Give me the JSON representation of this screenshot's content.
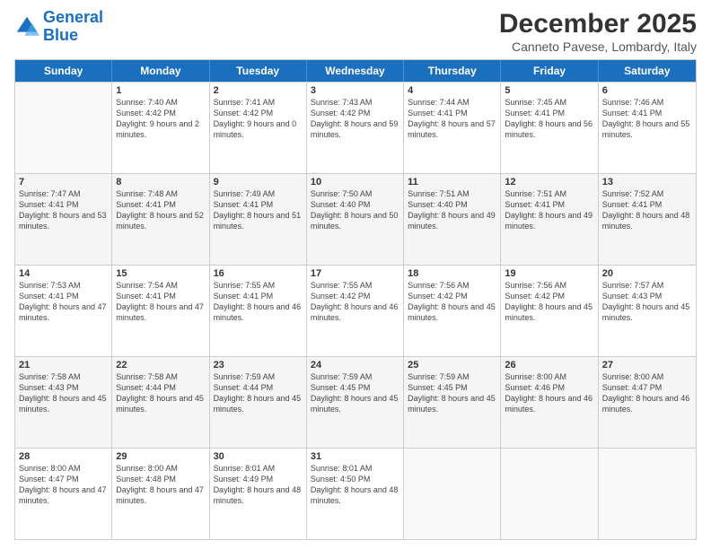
{
  "logo": {
    "line1": "General",
    "line2": "Blue"
  },
  "header": {
    "month": "December 2025",
    "location": "Canneto Pavese, Lombardy, Italy"
  },
  "days": [
    "Sunday",
    "Monday",
    "Tuesday",
    "Wednesday",
    "Thursday",
    "Friday",
    "Saturday"
  ],
  "rows": [
    [
      {
        "day": "",
        "sunrise": "",
        "sunset": "",
        "daylight": ""
      },
      {
        "day": "1",
        "sunrise": "Sunrise: 7:40 AM",
        "sunset": "Sunset: 4:42 PM",
        "daylight": "Daylight: 9 hours and 2 minutes."
      },
      {
        "day": "2",
        "sunrise": "Sunrise: 7:41 AM",
        "sunset": "Sunset: 4:42 PM",
        "daylight": "Daylight: 9 hours and 0 minutes."
      },
      {
        "day": "3",
        "sunrise": "Sunrise: 7:43 AM",
        "sunset": "Sunset: 4:42 PM",
        "daylight": "Daylight: 8 hours and 59 minutes."
      },
      {
        "day": "4",
        "sunrise": "Sunrise: 7:44 AM",
        "sunset": "Sunset: 4:41 PM",
        "daylight": "Daylight: 8 hours and 57 minutes."
      },
      {
        "day": "5",
        "sunrise": "Sunrise: 7:45 AM",
        "sunset": "Sunset: 4:41 PM",
        "daylight": "Daylight: 8 hours and 56 minutes."
      },
      {
        "day": "6",
        "sunrise": "Sunrise: 7:46 AM",
        "sunset": "Sunset: 4:41 PM",
        "daylight": "Daylight: 8 hours and 55 minutes."
      }
    ],
    [
      {
        "day": "7",
        "sunrise": "Sunrise: 7:47 AM",
        "sunset": "Sunset: 4:41 PM",
        "daylight": "Daylight: 8 hours and 53 minutes."
      },
      {
        "day": "8",
        "sunrise": "Sunrise: 7:48 AM",
        "sunset": "Sunset: 4:41 PM",
        "daylight": "Daylight: 8 hours and 52 minutes."
      },
      {
        "day": "9",
        "sunrise": "Sunrise: 7:49 AM",
        "sunset": "Sunset: 4:41 PM",
        "daylight": "Daylight: 8 hours and 51 minutes."
      },
      {
        "day": "10",
        "sunrise": "Sunrise: 7:50 AM",
        "sunset": "Sunset: 4:40 PM",
        "daylight": "Daylight: 8 hours and 50 minutes."
      },
      {
        "day": "11",
        "sunrise": "Sunrise: 7:51 AM",
        "sunset": "Sunset: 4:40 PM",
        "daylight": "Daylight: 8 hours and 49 minutes."
      },
      {
        "day": "12",
        "sunrise": "Sunrise: 7:51 AM",
        "sunset": "Sunset: 4:41 PM",
        "daylight": "Daylight: 8 hours and 49 minutes."
      },
      {
        "day": "13",
        "sunrise": "Sunrise: 7:52 AM",
        "sunset": "Sunset: 4:41 PM",
        "daylight": "Daylight: 8 hours and 48 minutes."
      }
    ],
    [
      {
        "day": "14",
        "sunrise": "Sunrise: 7:53 AM",
        "sunset": "Sunset: 4:41 PM",
        "daylight": "Daylight: 8 hours and 47 minutes."
      },
      {
        "day": "15",
        "sunrise": "Sunrise: 7:54 AM",
        "sunset": "Sunset: 4:41 PM",
        "daylight": "Daylight: 8 hours and 47 minutes."
      },
      {
        "day": "16",
        "sunrise": "Sunrise: 7:55 AM",
        "sunset": "Sunset: 4:41 PM",
        "daylight": "Daylight: 8 hours and 46 minutes."
      },
      {
        "day": "17",
        "sunrise": "Sunrise: 7:55 AM",
        "sunset": "Sunset: 4:42 PM",
        "daylight": "Daylight: 8 hours and 46 minutes."
      },
      {
        "day": "18",
        "sunrise": "Sunrise: 7:56 AM",
        "sunset": "Sunset: 4:42 PM",
        "daylight": "Daylight: 8 hours and 45 minutes."
      },
      {
        "day": "19",
        "sunrise": "Sunrise: 7:56 AM",
        "sunset": "Sunset: 4:42 PM",
        "daylight": "Daylight: 8 hours and 45 minutes."
      },
      {
        "day": "20",
        "sunrise": "Sunrise: 7:57 AM",
        "sunset": "Sunset: 4:43 PM",
        "daylight": "Daylight: 8 hours and 45 minutes."
      }
    ],
    [
      {
        "day": "21",
        "sunrise": "Sunrise: 7:58 AM",
        "sunset": "Sunset: 4:43 PM",
        "daylight": "Daylight: 8 hours and 45 minutes."
      },
      {
        "day": "22",
        "sunrise": "Sunrise: 7:58 AM",
        "sunset": "Sunset: 4:44 PM",
        "daylight": "Daylight: 8 hours and 45 minutes."
      },
      {
        "day": "23",
        "sunrise": "Sunrise: 7:59 AM",
        "sunset": "Sunset: 4:44 PM",
        "daylight": "Daylight: 8 hours and 45 minutes."
      },
      {
        "day": "24",
        "sunrise": "Sunrise: 7:59 AM",
        "sunset": "Sunset: 4:45 PM",
        "daylight": "Daylight: 8 hours and 45 minutes."
      },
      {
        "day": "25",
        "sunrise": "Sunrise: 7:59 AM",
        "sunset": "Sunset: 4:45 PM",
        "daylight": "Daylight: 8 hours and 45 minutes."
      },
      {
        "day": "26",
        "sunrise": "Sunrise: 8:00 AM",
        "sunset": "Sunset: 4:46 PM",
        "daylight": "Daylight: 8 hours and 46 minutes."
      },
      {
        "day": "27",
        "sunrise": "Sunrise: 8:00 AM",
        "sunset": "Sunset: 4:47 PM",
        "daylight": "Daylight: 8 hours and 46 minutes."
      }
    ],
    [
      {
        "day": "28",
        "sunrise": "Sunrise: 8:00 AM",
        "sunset": "Sunset: 4:47 PM",
        "daylight": "Daylight: 8 hours and 47 minutes."
      },
      {
        "day": "29",
        "sunrise": "Sunrise: 8:00 AM",
        "sunset": "Sunset: 4:48 PM",
        "daylight": "Daylight: 8 hours and 47 minutes."
      },
      {
        "day": "30",
        "sunrise": "Sunrise: 8:01 AM",
        "sunset": "Sunset: 4:49 PM",
        "daylight": "Daylight: 8 hours and 48 minutes."
      },
      {
        "day": "31",
        "sunrise": "Sunrise: 8:01 AM",
        "sunset": "Sunset: 4:50 PM",
        "daylight": "Daylight: 8 hours and 48 minutes."
      },
      {
        "day": "",
        "sunrise": "",
        "sunset": "",
        "daylight": ""
      },
      {
        "day": "",
        "sunrise": "",
        "sunset": "",
        "daylight": ""
      },
      {
        "day": "",
        "sunrise": "",
        "sunset": "",
        "daylight": ""
      }
    ]
  ]
}
